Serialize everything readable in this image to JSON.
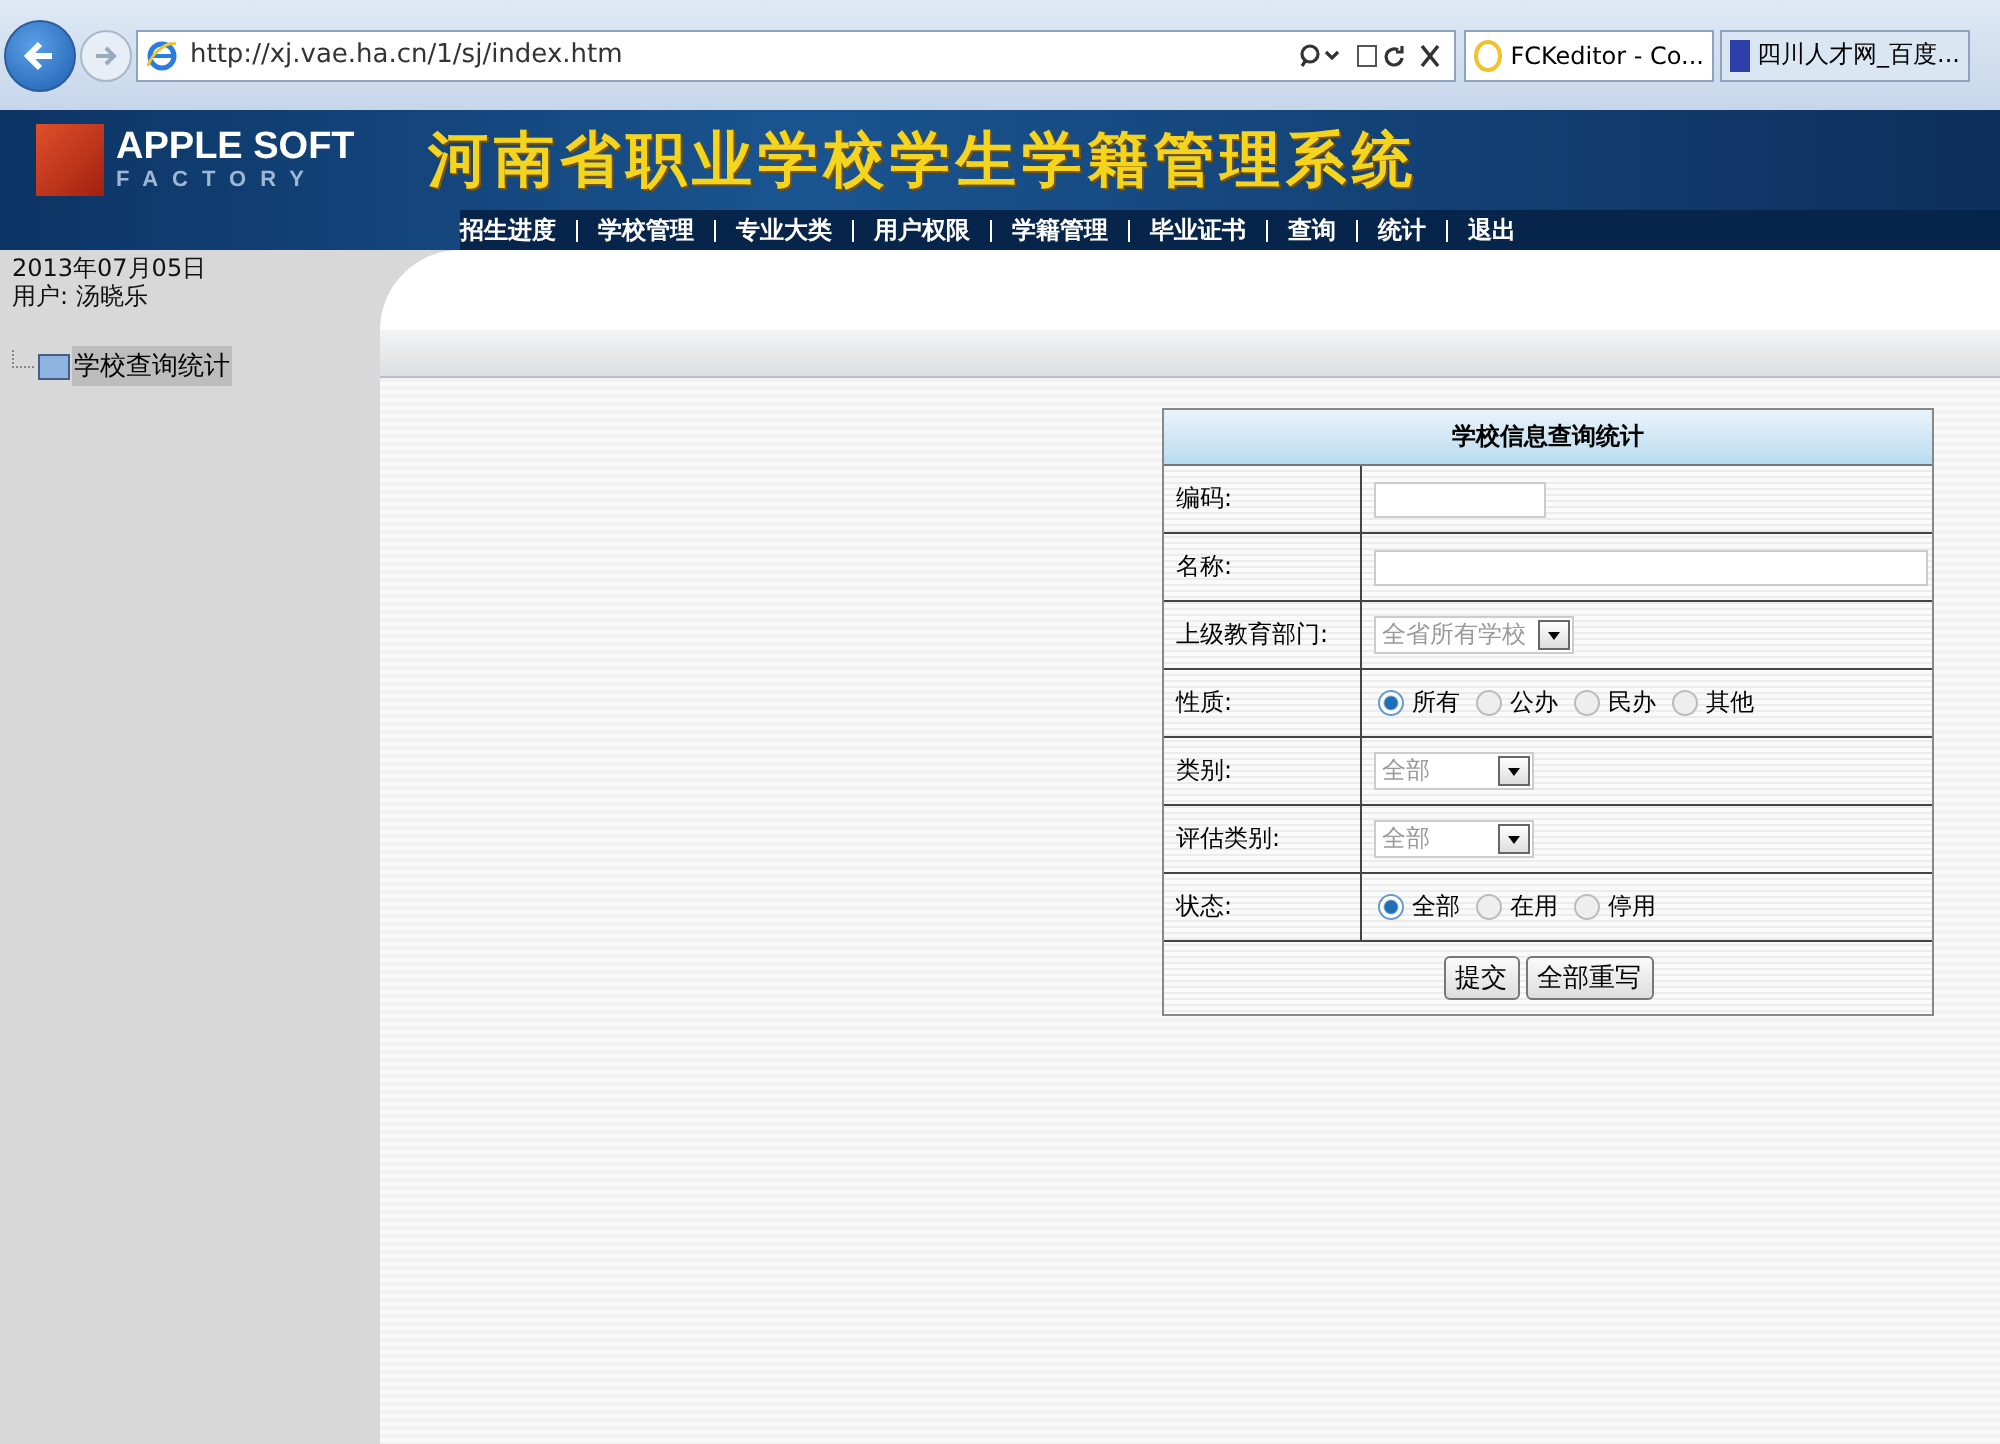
{
  "browser": {
    "address": "http://xj.vae.ha.cn/1/sj/index.htm",
    "tabs": [
      {
        "title": "FCKeditor - Co...",
        "selected": true
      },
      {
        "title": "四川人才网_百度...",
        "selected": false
      }
    ]
  },
  "banner": {
    "logo": [
      "APPLE SOFT",
      "FACTORY"
    ],
    "title": "河南省职业学校学生学籍管理系统",
    "nav": [
      "招生进度",
      "学校管理",
      "专业大类",
      "用户权限",
      "学籍管理",
      "毕业证书",
      "查询",
      "统计",
      "退出"
    ]
  },
  "sidebar": {
    "date": "2013年07月05日",
    "user": "用户: 汤晓乐",
    "tree": [
      {
        "label": "学校查询统计",
        "selected": true
      }
    ]
  },
  "form": {
    "title": "学校信息查询统计",
    "rows": [
      {
        "label": "编码:",
        "kind": "short-text"
      },
      {
        "label": "名称:",
        "kind": "text"
      },
      {
        "label": "上级教育部门:",
        "kind": "select",
        "value": "全省所有学校"
      },
      {
        "label": "性质:",
        "kind": "radio",
        "options": [
          {
            "text": "所有",
            "selected": true
          },
          {
            "text": "公办",
            "selected": false
          },
          {
            "text": "民办",
            "selected": false
          },
          {
            "text": "其他",
            "selected": false
          }
        ]
      },
      {
        "label": "类别:",
        "kind": "select",
        "value": "全部"
      },
      {
        "label": "评估类别:",
        "kind": "select",
        "value": "全部"
      },
      {
        "label": "状态:",
        "kind": "radio",
        "options": [
          {
            "text": "全部",
            "selected": true
          },
          {
            "text": "在用",
            "selected": false
          },
          {
            "text": "停用",
            "selected": false
          }
        ]
      }
    ],
    "buttons": [
      "提交",
      "全部重写"
    ]
  }
}
